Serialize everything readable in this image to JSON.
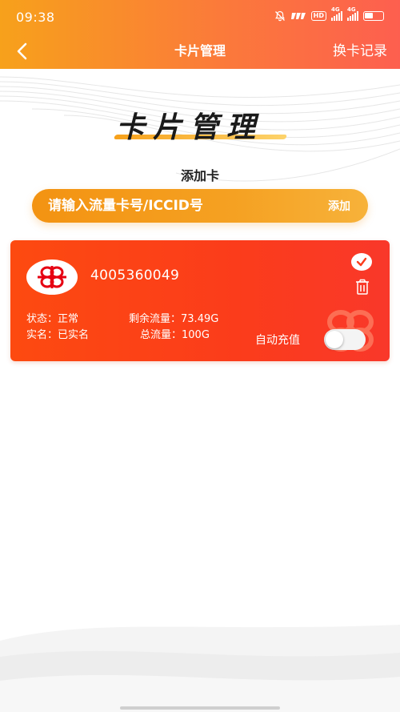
{
  "status_bar": {
    "time": "09:38",
    "hd_label": "HD",
    "sig1_label": "4G",
    "sig2_label": "4G"
  },
  "nav": {
    "title": "卡片管理",
    "history_label": "换卡记录"
  },
  "banner": {
    "title": "卡片管理",
    "add_heading": "添加卡",
    "input_placeholder": "请输入流量卡号/ICCID号",
    "add_button_label": "添加"
  },
  "card": {
    "number": "4005360049",
    "status_label": "状态：",
    "status_value": "正常",
    "realname_label": "实名：",
    "realname_value": "已实名",
    "remaining_label": "剩余流量：",
    "remaining_value": "73.49G",
    "total_label": "总流量：",
    "total_value": "100G",
    "auto_recharge_label": "自动充值",
    "auto_recharge_on": false
  },
  "colors": {
    "header_start": "#f7a11b",
    "header_end": "#fd5f4f",
    "card_red": "#fb3c1b",
    "add_bar_orange": "#f5a122"
  },
  "icons": [
    "back-chevron-icon",
    "mute-bell-icon",
    "check-icon",
    "trash-icon",
    "china-unicom-logo-icon"
  ]
}
